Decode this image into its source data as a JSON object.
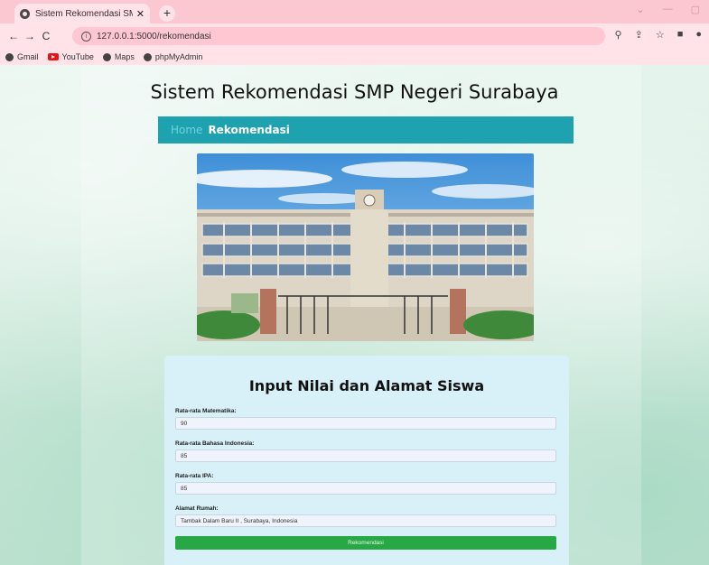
{
  "browser": {
    "tab_title": "Sistem Rekomendasi SMP Neg",
    "tab_close": "✕",
    "new_tab": "+",
    "window_controls": [
      "⌄",
      "—",
      "▢"
    ],
    "url": "127.0.0.1:5000/rekomendasi",
    "bookmarks": [
      {
        "label": "Gmail",
        "icon": "globe-icon"
      },
      {
        "label": "YouTube",
        "icon": "youtube-icon"
      },
      {
        "label": "Maps",
        "icon": "globe-icon"
      },
      {
        "label": "phpMyAdmin",
        "icon": "globe-icon"
      }
    ]
  },
  "site": {
    "title": "Sistem Rekomendasi SMP Negeri Surabaya",
    "nav": {
      "home": "Home",
      "rekomendasi": "Rekomendasi"
    }
  },
  "form": {
    "title": "Input Nilai dan Alamat Siswa",
    "fields": [
      {
        "label": "Rata-rata Matematika:",
        "value": "90"
      },
      {
        "label": "Rata-rata Bahasa Indonesia:",
        "value": "85"
      },
      {
        "label": "Rata-rata IPA:",
        "value": "85"
      },
      {
        "label": "Alamat Rumah:",
        "value": "Tambak Dalam Baru II , Surabaya, Indonesia"
      }
    ],
    "submit_label": "Rekomendasi"
  },
  "colors": {
    "navbar": "#1fa2b0",
    "submit": "#28a745",
    "form_card": "#d8f0f8",
    "tabbar": "#fbc8d2"
  }
}
